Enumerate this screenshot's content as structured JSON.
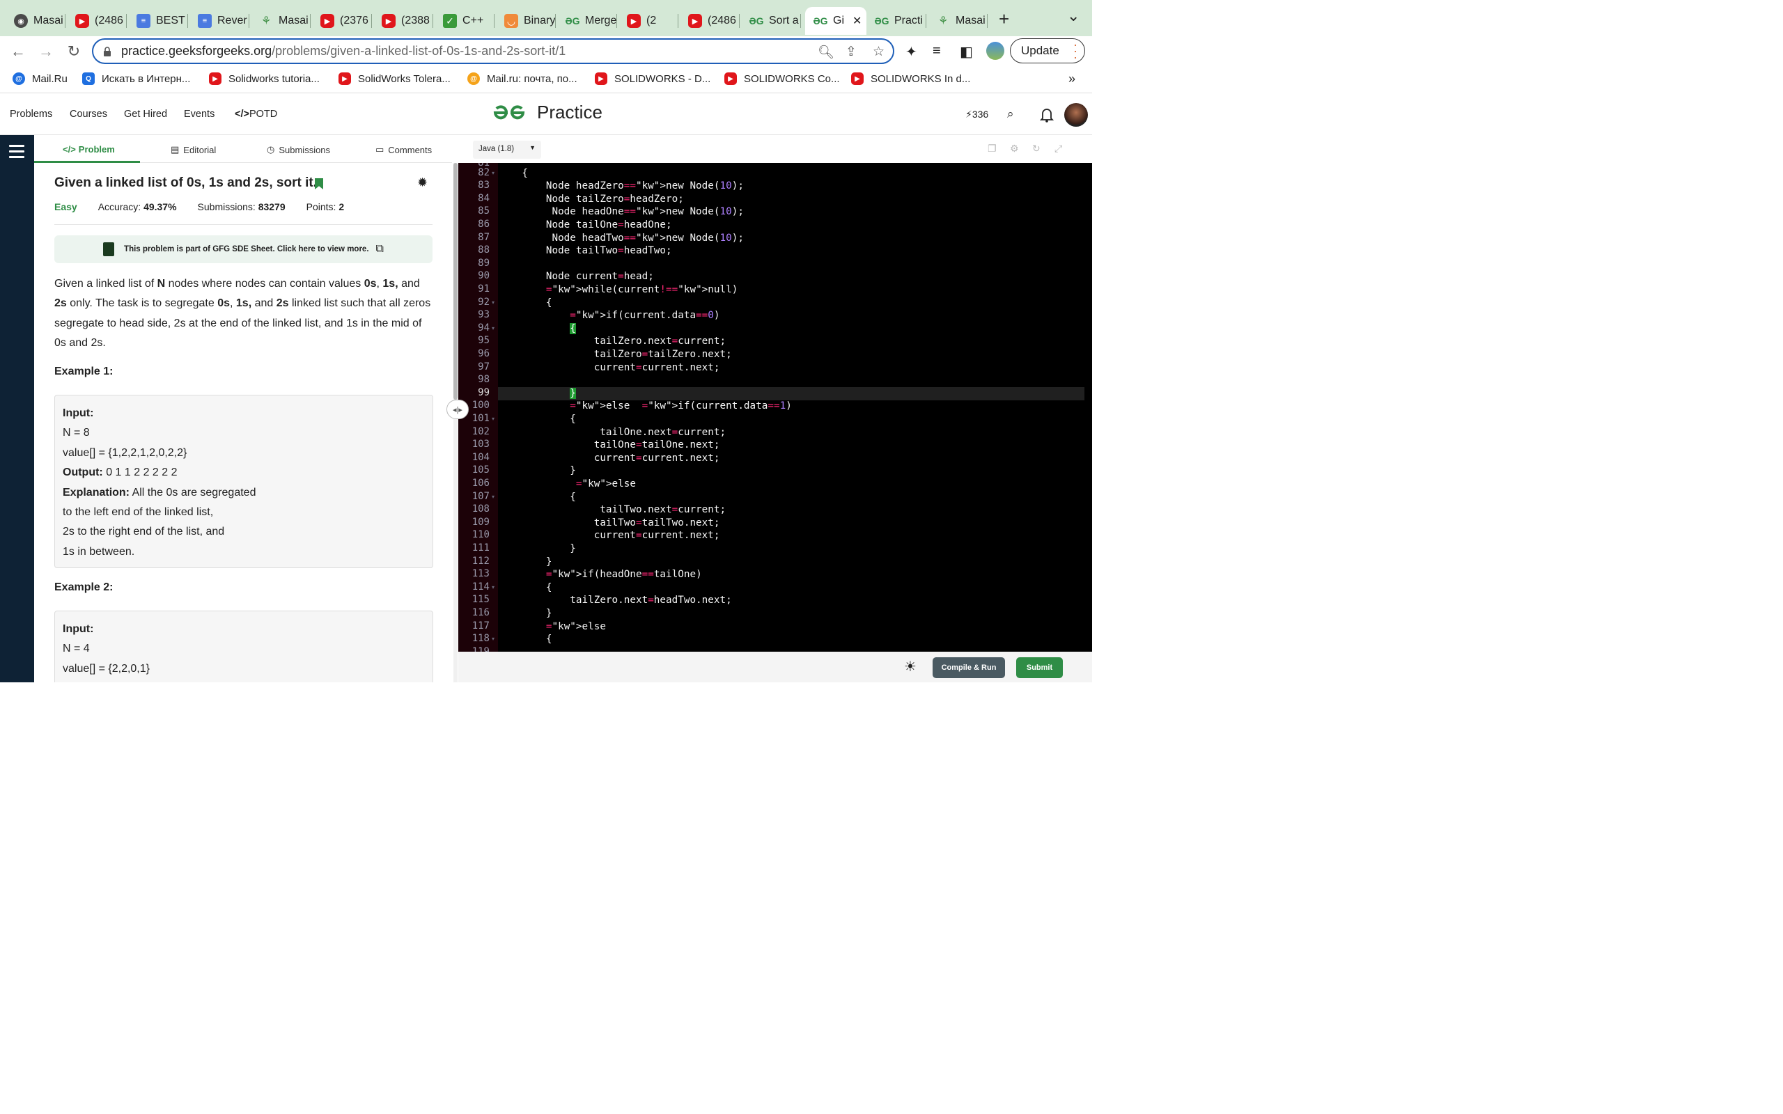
{
  "browser": {
    "tabs": [
      {
        "title": "Masai",
        "fav": "globe"
      },
      {
        "title": "(2486",
        "fav": "yt"
      },
      {
        "title": "BEST",
        "fav": "doc"
      },
      {
        "title": "Rever",
        "fav": "doc"
      },
      {
        "title": "Masai",
        "fav": "pin"
      },
      {
        "title": "(2376",
        "fav": "yt"
      },
      {
        "title": "(2388",
        "fav": "yt"
      },
      {
        "title": "C++",
        "fav": "check"
      },
      {
        "title": "Binary",
        "fav": "binary"
      },
      {
        "title": "Merge",
        "fav": "gfg"
      },
      {
        "title": "(2",
        "fav": "yt"
      },
      {
        "title": "(2486",
        "fav": "yt"
      },
      {
        "title": "Sort a",
        "fav": "gfg"
      },
      {
        "title": "Gi",
        "fav": "gfg",
        "active": true
      },
      {
        "title": "Practi",
        "fav": "gfg"
      },
      {
        "title": "Masai",
        "fav": "pin"
      }
    ],
    "url_host": "practice.geeksforgeeks.org",
    "url_path": "/problems/given-a-linked-list-of-0s-1s-and-2s-sort-it/1",
    "update_label": "Update",
    "bookmarks": [
      {
        "label": "Mail.Ru",
        "icon": "mail"
      },
      {
        "label": "Искать в Интерн...",
        "icon": "ya"
      },
      {
        "label": "Solidworks tutoria...",
        "icon": "yt"
      },
      {
        "label": "SolidWorks Tolera...",
        "icon": "yt"
      },
      {
        "label": "Mail.ru: почта, по...",
        "icon": "mailo"
      },
      {
        "label": "SOLIDWORKS - D...",
        "icon": "yt"
      },
      {
        "label": "SOLIDWORKS Co...",
        "icon": "yt"
      },
      {
        "label": "SOLIDWORKS In d...",
        "icon": "yt"
      }
    ],
    "bookmarks_more": "»"
  },
  "site": {
    "nav": [
      "Problems",
      "Courses",
      "Get Hired",
      "Events",
      "POTD"
    ],
    "potd_icon": "</>",
    "logo_text": "Practice",
    "streak": "336"
  },
  "problem_tabs": [
    "Problem",
    "Editorial",
    "Submissions",
    "Comments"
  ],
  "problem": {
    "title": "Given a linked list of 0s, 1s and 2s, sort it.",
    "difficulty": "Easy",
    "accuracy_label": "Accuracy:",
    "accuracy": "49.37%",
    "submissions_label": "Submissions:",
    "submissions": "83279",
    "points_label": "Points:",
    "points": "2",
    "sde_banner": "This problem is part of GFG SDE Sheet. Click here to view more.",
    "desc": {
      "p1": "Given a linked list of ",
      "n": "N",
      "p2": " nodes where nodes can contain values ",
      "v0": "0s",
      "c1": ", ",
      "v1": "1s,",
      "p3": " and ",
      "v2": "2s",
      "p4": " only. The task is to segregate ",
      "w0": "0s",
      "c2": ", ",
      "w1": "1s,",
      "p5": " and ",
      "w2": "2s",
      "p6": " linked list such that all zeros segregate to head side, 2s at the end of the linked list, and 1s in the mid of 0s and 2s."
    },
    "example1": {
      "heading": "Example 1:",
      "input_label": "Input:",
      "n_line": "N = 8",
      "value_line": "value[] = {1,2,2,1,2,0,2,2}",
      "output_label": "Output:",
      "output": " 0 1 1 2 2 2 2 2",
      "expl_label": "Explanation:",
      "expl1": " All the 0s are segregated",
      "expl2": "to the left end of the linked list,",
      "expl3": "2s to the right end of the list, and",
      "expl4": "1s in between."
    },
    "example2": {
      "heading": "Example 2:",
      "input_label": "Input:",
      "n_line": "N = 4",
      "value_line": "value[] = {2,2,0,1}"
    }
  },
  "editor": {
    "language": "Java (1.8)",
    "first_line": 82,
    "folded_lines": [
      82,
      92,
      94,
      101,
      107,
      114,
      118
    ],
    "lines": [
      "    {",
      "        Node headZero=new Node(10);",
      "        Node tailZero=headZero;",
      "         Node headOne=new Node(10);",
      "        Node tailOne=headOne;",
      "         Node headTwo=new Node(10);",
      "        Node tailTwo=headTwo;",
      "",
      "        Node current=head;",
      "        while(current!=null)",
      "        {",
      "            if(current.data==0)",
      "            {",
      "                tailZero.next=current;",
      "                tailZero=tailZero.next;",
      "                current=current.next;",
      "",
      "            }",
      "            else  if(current.data==1)",
      "            {",
      "                 tailOne.next=current;",
      "                tailOne=tailOne.next;",
      "                current=current.next;",
      "            }",
      "             else",
      "            {",
      "                 tailTwo.next=current;",
      "                tailTwo=tailTwo.next;",
      "                current=current.next;",
      "            }",
      "        }",
      "        if(headOne==tailOne)",
      "        {",
      "            tailZero.next=headTwo.next;",
      "        }",
      "        else",
      "        {"
    ],
    "current_line": 99,
    "compile_label": "Compile & Run",
    "submit_label": "Submit"
  },
  "colors": {
    "brand": "#2f8d46",
    "keyword": "#f92672",
    "number": "#ae81ff"
  }
}
